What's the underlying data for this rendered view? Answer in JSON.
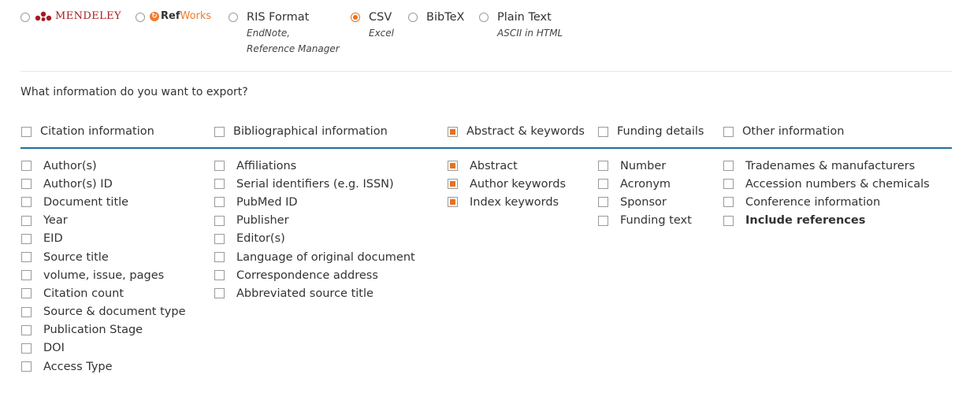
{
  "formats": {
    "mendeley": {
      "brand": "MENDELEY",
      "brand_color": "#a8191e"
    },
    "refworks": {
      "brand_ref": "Ref",
      "brand_works": "Works",
      "brand_color": "#f07c2a"
    },
    "ris": {
      "label": "RIS Format",
      "sub1": "EndNote,",
      "sub2": "Reference Manager"
    },
    "csv": {
      "label": "CSV",
      "sub1": "Excel",
      "selected": true
    },
    "bibtex": {
      "label": "BibTeX"
    },
    "plain": {
      "label": "Plain Text",
      "sub1": "ASCII in HTML"
    }
  },
  "question": "What information do you want to export?",
  "accent_color": "#e9711c",
  "rule_color": "#1e6f9f",
  "groups": {
    "citation": {
      "label": "Citation information",
      "checked": false,
      "items": [
        "Author(s)",
        "Author(s) ID",
        "Document title",
        "Year",
        "EID",
        "Source title",
        "volume, issue, pages",
        "Citation count",
        "Source & document type",
        "Publication Stage",
        "DOI",
        "Access Type"
      ]
    },
    "bibliographical": {
      "label": "Bibliographical information",
      "checked": false,
      "items": [
        "Affiliations",
        "Serial identifiers (e.g. ISSN)",
        "PubMed ID",
        "Publisher",
        "Editor(s)",
        "Language of original document",
        "Correspondence address",
        "Abbreviated source title"
      ]
    },
    "abstract": {
      "label": "Abstract & keywords",
      "checked": true,
      "items": [
        "Abstract",
        "Author keywords",
        "Index keywords"
      ]
    },
    "funding": {
      "label": "Funding details",
      "checked": false,
      "items": [
        "Number",
        "Acronym",
        "Sponsor",
        "Funding text"
      ]
    },
    "other": {
      "label": "Other information",
      "checked": false,
      "items": [
        "Tradenames & manufacturers",
        "Accession numbers & chemicals",
        "Conference information",
        "Include references"
      ]
    }
  }
}
